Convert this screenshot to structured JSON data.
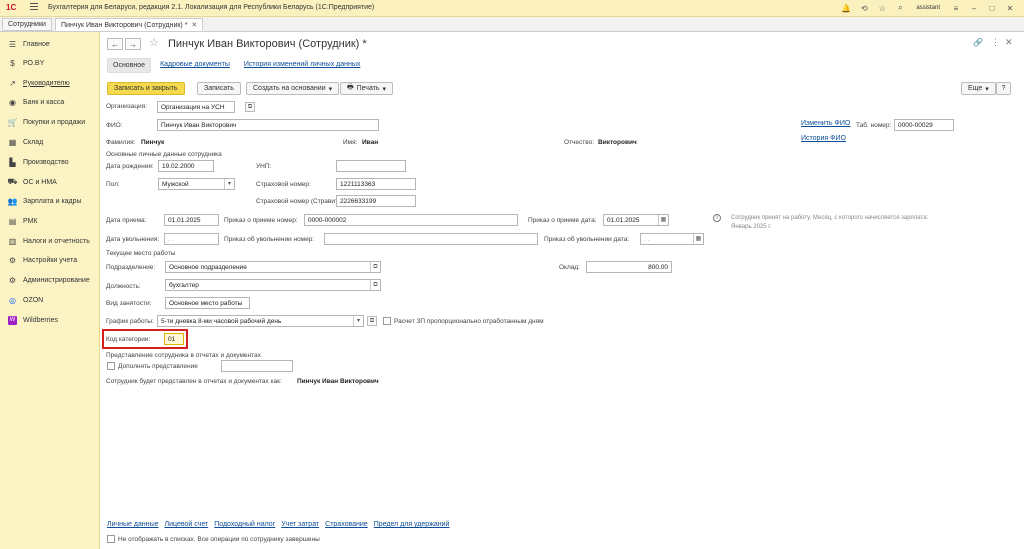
{
  "window": {
    "app_title": "Бухгалтерия для Беларуси, редакция 2.1. Локализация для Республики Беларусь  (1С:Предприятие)",
    "logo": "1С",
    "user": "assistant"
  },
  "tabs": [
    {
      "label": "Сотрудники"
    },
    {
      "label": "Пинчук Иван Викторович (Сотрудник) *"
    }
  ],
  "sidebar": {
    "items": [
      {
        "label": "Главное",
        "icon": "menu-icon"
      },
      {
        "label": "РО.BY",
        "icon": "dollar-icon"
      },
      {
        "label": "Руководителю",
        "icon": "chart-icon"
      },
      {
        "label": "Банк и касса",
        "icon": "bank-icon"
      },
      {
        "label": "Покупки и продажи",
        "icon": "cart-icon"
      },
      {
        "label": "Склад",
        "icon": "warehouse-icon"
      },
      {
        "label": "Производство",
        "icon": "factory-icon"
      },
      {
        "label": "ОС и НМА",
        "icon": "assets-icon"
      },
      {
        "label": "Зарплата и кадры",
        "icon": "people-icon"
      },
      {
        "label": "РМК",
        "icon": "register-icon"
      },
      {
        "label": "Налоги и отчетность",
        "icon": "tax-icon"
      },
      {
        "label": "Настройки учета",
        "icon": "settings-icon"
      },
      {
        "label": "Администрирование",
        "icon": "gear-icon"
      },
      {
        "label": "OZON",
        "icon": "ozon-icon"
      },
      {
        "label": "Wildberries",
        "icon": "wildberries-icon"
      }
    ]
  },
  "form": {
    "title": "Пинчук Иван Викторович (Сотрудник) *",
    "subtabs": [
      "Основное",
      "Кадровые документы",
      "История изменений личных данных"
    ],
    "toolbar": {
      "save_close": "Записать и закрыть",
      "save": "Записать",
      "create_based": "Создать на основании",
      "print": "Печать",
      "more": "Еще"
    },
    "org_label": "Организация:",
    "org_value": "Организация на УСН",
    "fio_label": "ФИО:",
    "fio_value": "Пинчук Иван Викторович",
    "change_fio": "Изменить ФИО",
    "fio_history": "История ФИО",
    "tab_num_label": "Таб. номер:",
    "tab_num_value": "0000-00029",
    "surname_label": "Фамилия:",
    "surname_value": "Пинчук",
    "name_label": "Имя:",
    "name_value": "Иван",
    "patronymic_label": "Отчество:",
    "patronymic_value": "Викторович",
    "personal_section": "Основные личные данные сотрудника",
    "birth_label": "Дата рождения:",
    "birth_value": "19.02.2000",
    "unp_label": "УНП:",
    "unp_value": "",
    "gender_label": "Пол:",
    "gender_value": "Мужской",
    "ins_num_label": "Страховой номер:",
    "ins_num_value": "1221113363",
    "ins_num2_label": "Страховой номер (Стравита):",
    "ins_num2_value": "2226633199",
    "hire_date_label": "Дата приема:",
    "hire_date_value": "01.01.2025",
    "hire_order_num_label": "Приказ о приеме номер:",
    "hire_order_num_value": "0000-000002",
    "hire_order_date_label": "Приказ о приеме дата:",
    "hire_order_date_value": "01.01.2025",
    "hire_info": "Сотрудник принят на работу. Месяц, с которого начисляется зарплата: Январь 2025 г.",
    "dismiss_date_label": "Дата увольнения:",
    "dismiss_date_value": " .  .",
    "dismiss_order_num_label": "Приказ об увольнении номер:",
    "dismiss_order_num_value": "",
    "dismiss_order_date_label": "Приказ об увольнении дата:",
    "dismiss_order_date_value": " .  .",
    "workplace_section": "Текущее место работы",
    "dept_label": "Подразделение:",
    "dept_value": "Основное подразделение",
    "salary_label": "Оклад:",
    "salary_value": "800.00",
    "position_label": "Должность:",
    "position_value": "бухгалтер",
    "employment_label": "Вид занятости:",
    "employment_value": "Основное место работы",
    "schedule_label": "График работы:",
    "schedule_value": "5-ти дневка 8-ми часовой рабочий день",
    "prop_calc_label": "Расчет ЗП пропорционально отработанным дням",
    "category_label": "Код категории:",
    "category_value": "01",
    "repr_section": "Представление сотрудника в отчетах и документах",
    "repr_extra_label": "Дополнять представление",
    "repr_text_label": "Сотрудник будет представлен в отчетах и документах как:",
    "repr_text_value": "Пинчук Иван Викторович",
    "bottom_links": [
      "Личные данные",
      "Лицевой счет",
      "Подоходный налог",
      "Учет затрат",
      "Страхование",
      "Предел для удержаний"
    ],
    "not_show_label": "Не отображать в списках. Все операции по сотруднику завершены"
  }
}
